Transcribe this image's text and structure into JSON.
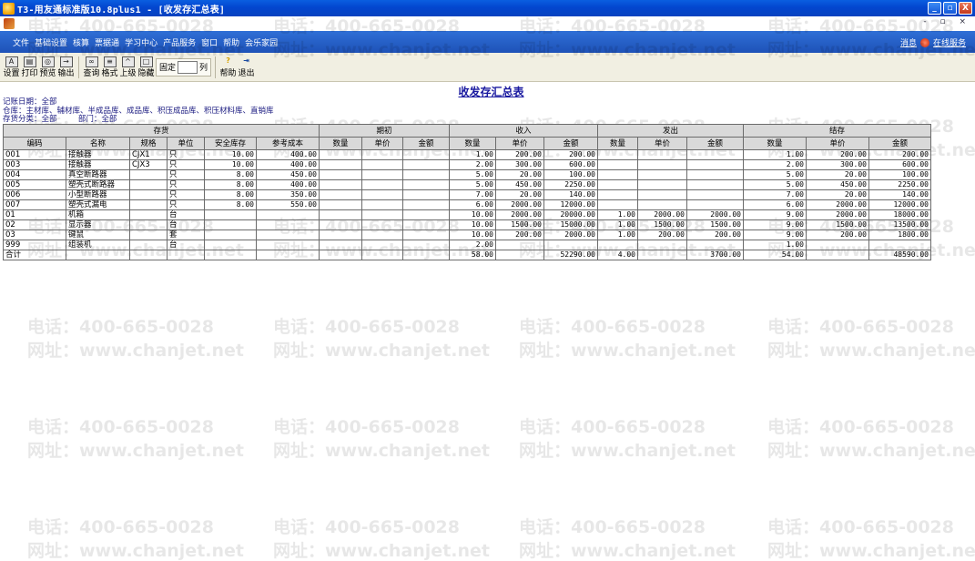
{
  "window": {
    "title": "T3-用友通标准版10.8plus1 - [收发存汇总表]",
    "controls": [
      "_",
      "▫",
      "X"
    ]
  },
  "mdi": {
    "controls": "- ▫ ×"
  },
  "menu": {
    "items": [
      "文件",
      "基础设置",
      "核算",
      "票据通",
      "学习中心",
      "产品服务",
      "窗口",
      "帮助",
      "会乐家园"
    ],
    "right": {
      "message": "消息",
      "online": "在线服务"
    }
  },
  "toolbar": {
    "buttons": [
      {
        "label": "设置",
        "icon": "settings-icon",
        "glyph": "A"
      },
      {
        "label": "打印",
        "icon": "print-icon",
        "glyph": "▤"
      },
      {
        "label": "预览",
        "icon": "preview-icon",
        "glyph": "◎"
      },
      {
        "label": "输出",
        "icon": "export-icon",
        "glyph": "→"
      },
      {
        "label": "查询",
        "icon": "binoculars-icon",
        "glyph": "∞"
      },
      {
        "label": "格式",
        "icon": "format-icon",
        "glyph": "≡"
      },
      {
        "label": "上级",
        "icon": "up-level-icon",
        "glyph": "^"
      },
      {
        "label": "隐藏",
        "icon": "hide-icon",
        "glyph": "□"
      }
    ],
    "fixed_label": "固定",
    "fixed_value": "",
    "column_label": "列",
    "help_label": "帮助",
    "exit_label": "退出"
  },
  "report": {
    "title": "收发存汇总表",
    "filters": {
      "date": "记账日期：全部",
      "warehouse": "仓库：主材库、辅材库、半成品库、成品库、积压成品库、积压材料库、直销库",
      "category": "存货分类：全部",
      "department": "部门：全部"
    }
  },
  "table": {
    "groups": [
      "存货",
      "期初",
      "收入",
      "发出",
      "结存"
    ],
    "columns": [
      "编码",
      "名称",
      "规格",
      "单位",
      "安全库存",
      "参考成本",
      "数量",
      "单价",
      "金额",
      "数量",
      "单价",
      "金额",
      "数量",
      "单价",
      "金额",
      "数量",
      "单价",
      "金额"
    ],
    "rows": [
      [
        "001",
        "接触器",
        "CJX1",
        "只",
        "10.00",
        "400.00",
        "",
        "",
        "",
        "1.00",
        "200.00",
        "200.00",
        "",
        "",
        "",
        "1.00",
        "200.00",
        "200.00"
      ],
      [
        "003",
        "接触器",
        "CJX3",
        "只",
        "10.00",
        "400.00",
        "",
        "",
        "",
        "2.00",
        "300.00",
        "600.00",
        "",
        "",
        "",
        "2.00",
        "300.00",
        "600.00"
      ],
      [
        "004",
        "真空断路器",
        "",
        "只",
        "8.00",
        "450.00",
        "",
        "",
        "",
        "5.00",
        "20.00",
        "100.00",
        "",
        "",
        "",
        "5.00",
        "20.00",
        "100.00"
      ],
      [
        "005",
        "塑壳式断路器",
        "",
        "只",
        "8.00",
        "400.00",
        "",
        "",
        "",
        "5.00",
        "450.00",
        "2250.00",
        "",
        "",
        "",
        "5.00",
        "450.00",
        "2250.00"
      ],
      [
        "006",
        "小型断路器",
        "",
        "只",
        "8.00",
        "350.00",
        "",
        "",
        "",
        "7.00",
        "20.00",
        "140.00",
        "",
        "",
        "",
        "7.00",
        "20.00",
        "140.00"
      ],
      [
        "007",
        "塑壳式漏电",
        "",
        "只",
        "8.00",
        "550.00",
        "",
        "",
        "",
        "6.00",
        "2000.00",
        "12000.00",
        "",
        "",
        "",
        "6.00",
        "2000.00",
        "12000.00"
      ],
      [
        "01",
        "机箱",
        "",
        "台",
        "",
        "",
        "",
        "",
        "",
        "10.00",
        "2000.00",
        "20000.00",
        "1.00",
        "2000.00",
        "2000.00",
        "9.00",
        "2000.00",
        "18000.00"
      ],
      [
        "02",
        "显示器",
        "",
        "台",
        "",
        "",
        "",
        "",
        "",
        "10.00",
        "1500.00",
        "15000.00",
        "1.00",
        "1500.00",
        "1500.00",
        "9.00",
        "1500.00",
        "13500.00"
      ],
      [
        "03",
        "键鼠",
        "",
        "套",
        "",
        "",
        "",
        "",
        "",
        "10.00",
        "200.00",
        "2000.00",
        "1.00",
        "200.00",
        "200.00",
        "9.00",
        "200.00",
        "1800.00"
      ],
      [
        "999",
        "组装机",
        "",
        "台",
        "",
        "",
        "",
        "",
        "",
        "2.00",
        "",
        "",
        "",
        "",
        "",
        "1.00",
        "",
        ""
      ],
      [
        "合计",
        "",
        "",
        "",
        "",
        "",
        "",
        "",
        "",
        "58.00",
        "",
        "52290.00",
        "4.00",
        "",
        "3700.00",
        "54.00",
        "",
        "48590.00"
      ]
    ]
  },
  "watermark": {
    "phone": "电话：400-665-0028",
    "site": "网址：www.chanjet.net"
  }
}
